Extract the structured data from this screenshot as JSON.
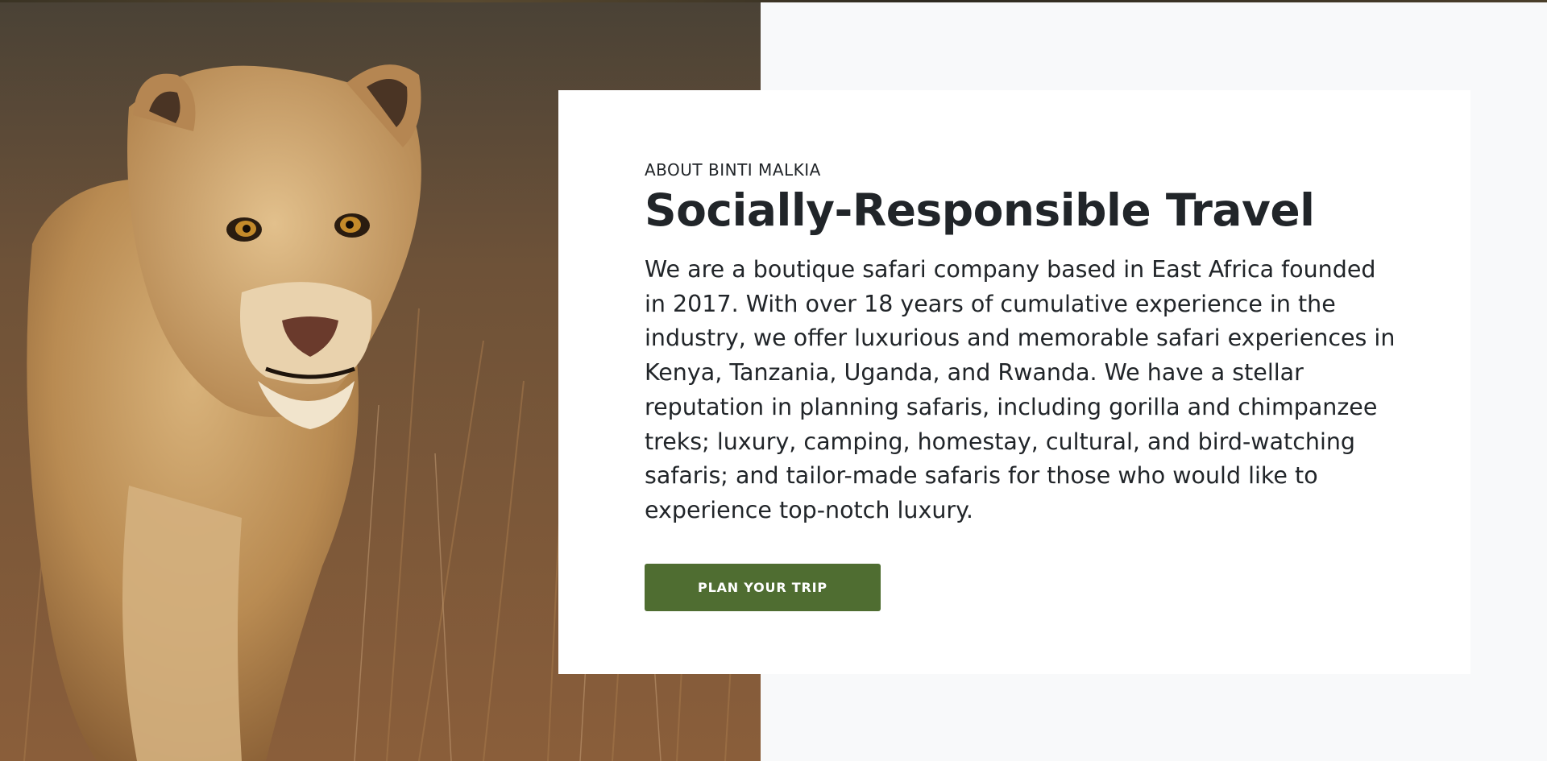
{
  "about": {
    "eyebrow": "ABOUT BINTI MALKIA",
    "title": "Socially-Responsible Travel",
    "body": "We are a boutique safari company based in East Africa founded in 2017. With over 18 years of cumulative experience in the industry, we offer luxurious and memorable safari experiences in Kenya, Tanzania, Uganda, and Rwanda. We have a stellar reputation in planning safaris, including gorilla and chimpanzee treks; luxury, camping, homestay, cultural, and bird-watching safaris; and tailor-made safaris for those who would like to experience top-notch luxury.",
    "cta_label": "PLAN YOUR TRIP"
  },
  "colors": {
    "cta_background": "#4f6d31",
    "text": "#212529",
    "page_background": "#f8f9fa",
    "card_background": "#ffffff"
  },
  "image": {
    "subject": "lioness-walking-through-grass"
  }
}
